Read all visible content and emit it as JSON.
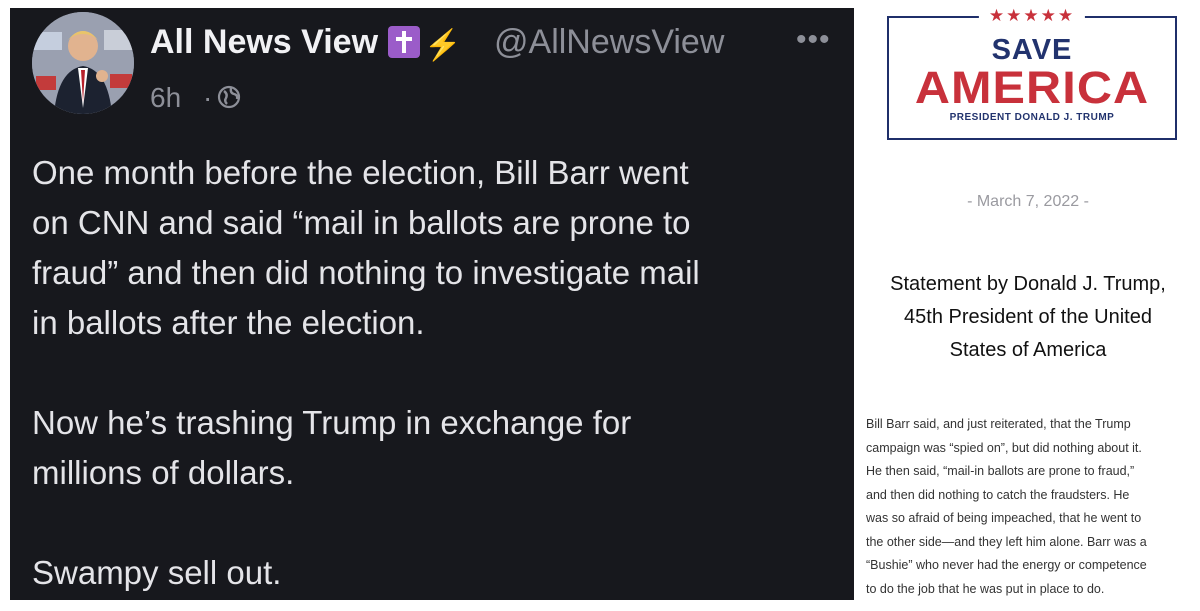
{
  "post": {
    "author_name": "All News View",
    "badge_icons": [
      "latin-cross-icon",
      "lightning-bolt-icon"
    ],
    "handle": "@AllNewsView",
    "time": "6h",
    "separator": "·",
    "body_lines": [
      "One month before the election, Bill Barr went",
      "on CNN and said “mail in ballots are prone to",
      "fraud” and then did nothing to investigate mail",
      "in ballots after the election.",
      "Now he’s trashing Trump in exchange for",
      "millions of dollars.",
      "Swampy sell out."
    ]
  },
  "statement": {
    "logo": {
      "stars": "★★★★★",
      "save": "SAVE",
      "america": "AMERICA",
      "president": "PRESIDENT DONALD J. TRUMP"
    },
    "date": "- March 7, 2022 -",
    "heading_lines": [
      "Statement by Donald J. Trump,",
      "45th President of the United",
      "States of America"
    ],
    "body_lines": [
      "Bill Barr said, and just reiterated, that the Trump",
      "campaign was “spied on”, but did nothing about it.",
      "He then said, “mail-in ballots are prone to fraud,”",
      "and then did nothing to catch the fraudsters. He",
      "was so afraid of being impeached, that he went to",
      "the other side—and they left him alone. Barr was a",
      "“Bushie” who never had the energy or competence",
      "to do the job that he was put in place to do."
    ]
  },
  "colors": {
    "post_bg": "#17181d",
    "logo_red": "#c8313b",
    "logo_blue": "#22336e",
    "badge_purple": "#9b5cc9",
    "bolt_yellow": "#ffc21a"
  }
}
